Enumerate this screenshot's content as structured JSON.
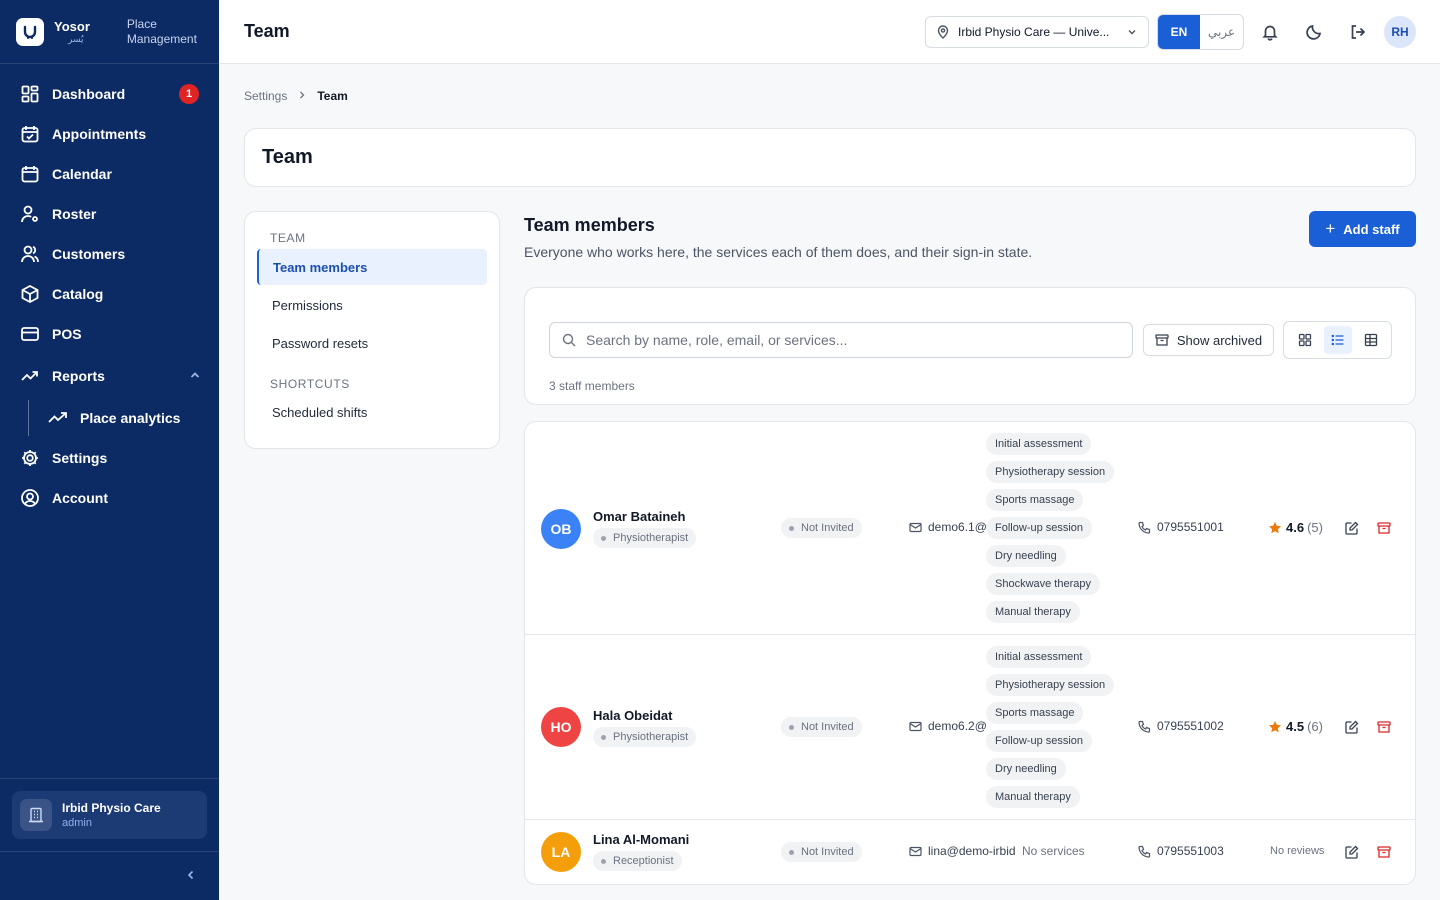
{
  "brand": {
    "name": "Yosor",
    "sub": "يُسر",
    "tag_line1": "Place",
    "tag_line2": "Management"
  },
  "sidebar": {
    "items": [
      {
        "label": "Dashboard",
        "badge": "1"
      },
      {
        "label": "Appointments"
      },
      {
        "label": "Calendar"
      },
      {
        "label": "Roster"
      },
      {
        "label": "Customers"
      },
      {
        "label": "Catalog"
      },
      {
        "label": "POS"
      },
      {
        "label": "Reports"
      },
      {
        "label": "Place analytics"
      },
      {
        "label": "Settings"
      },
      {
        "label": "Account"
      }
    ],
    "place": {
      "name": "Irbid Physio Care",
      "role": "admin"
    }
  },
  "header": {
    "title": "Team",
    "location": "Irbid Physio Care — Unive...",
    "lang_en": "EN",
    "lang_ar": "عربي",
    "user_initials": "RH"
  },
  "breadcrumb": {
    "parent": "Settings",
    "current": "Team"
  },
  "page_title": "Team",
  "subnav": {
    "section_team": "TEAM",
    "team_members": "Team members",
    "permissions": "Permissions",
    "password_resets": "Password resets",
    "section_shortcuts": "SHORTCUTS",
    "scheduled_shifts": "Scheduled shifts"
  },
  "main": {
    "title": "Team members",
    "subtitle": "Everyone who works here, the services each of them does, and their sign-in state.",
    "add_staff": "Add staff",
    "search_placeholder": "Search by name, role, email, or services...",
    "show_archived": "Show archived",
    "count": "3 staff members"
  },
  "members": [
    {
      "initials": "OB",
      "avatar_color": "#3b82f6",
      "name": "Omar Bataineh",
      "role": "Physiotherapist",
      "status": "Not Invited",
      "email": "demo6.1@",
      "services": [
        "Initial assessment",
        "Physiotherapy session",
        "Sports massage",
        "Follow-up session",
        "Dry needling",
        "Shockwave therapy",
        "Manual therapy"
      ],
      "phone": "0795551001",
      "rating": "4.6",
      "reviews": "(5)"
    },
    {
      "initials": "HO",
      "avatar_color": "#ef4444",
      "name": "Hala Obeidat",
      "role": "Physiotherapist",
      "status": "Not Invited",
      "email": "demo6.2@",
      "services": [
        "Initial assessment",
        "Physiotherapy session",
        "Sports massage",
        "Follow-up session",
        "Dry needling",
        "Manual therapy"
      ],
      "phone": "0795551002",
      "rating": "4.5",
      "reviews": "(6)"
    },
    {
      "initials": "LA",
      "avatar_color": "#f59e0b",
      "name": "Lina Al-Momani",
      "role": "Receptionist",
      "status": "Not Invited",
      "email": "lina@demo-irbid",
      "no_services": "No services",
      "phone": "0795551003",
      "no_reviews": "No reviews"
    }
  ]
}
